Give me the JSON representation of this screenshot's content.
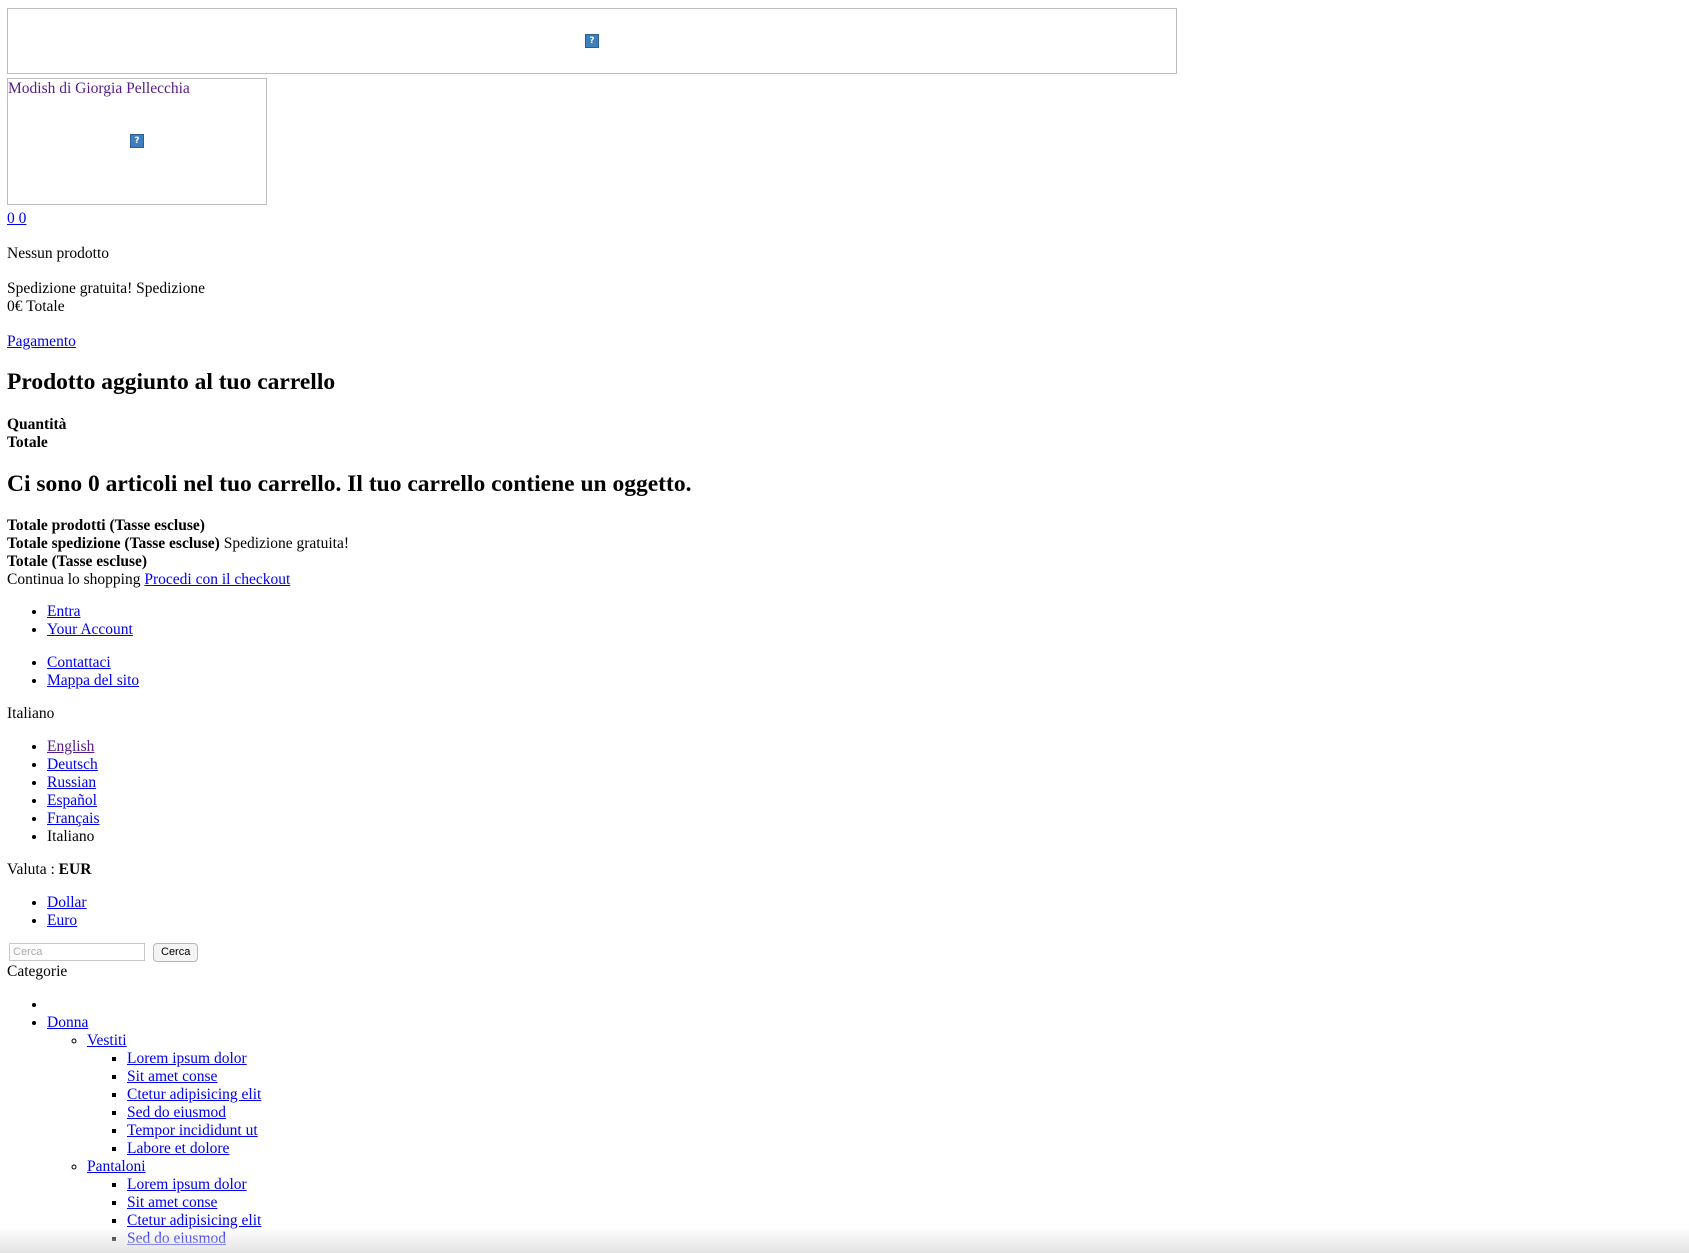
{
  "header": {
    "banner_icon": "broken-image-icon",
    "logo_text": "Modish di Giorgia Pellecchia",
    "logo_icon": "broken-image-icon"
  },
  "cart": {
    "count_link": "0 0",
    "empty_text": "Nessun prodotto",
    "shipping_line": "Spedizione gratuita! Spedizione",
    "total_line": "0€ Totale",
    "checkout_link": "Pagamento"
  },
  "layer_cart": {
    "title": "Prodotto aggiunto al tuo carrello",
    "quantity_label": "Quantità",
    "total_label": "Totale",
    "summary_heading": "Ci sono 0 articoli nel tuo carrello. Il tuo carrello contiene un oggetto.",
    "products_total_label": "Totale prodotti (Tasse escluse)",
    "shipping_total_label": "Totale spedizione (Tasse escluse)",
    "shipping_total_value": "Spedizione gratuita!",
    "grand_total_label": "Totale (Tasse escluse)",
    "continue_label": "Continua lo shopping",
    "proceed_link": "Procedi con il checkout"
  },
  "user_nav": [
    {
      "label": "Entra"
    },
    {
      "label": "Your Account"
    }
  ],
  "contact_nav": [
    {
      "label": "Contattaci"
    },
    {
      "label": "Mappa del sito"
    }
  ],
  "language": {
    "current": "Italiano",
    "options": [
      {
        "label": "English",
        "visited": true
      },
      {
        "label": "Deutsch"
      },
      {
        "label": "Russian"
      },
      {
        "label": "Español"
      },
      {
        "label": "Français"
      },
      {
        "label": "Italiano",
        "current": true
      }
    ]
  },
  "currency": {
    "label": "Valuta :",
    "value": "EUR",
    "options": [
      {
        "label": "Dollar"
      },
      {
        "label": "Euro"
      }
    ]
  },
  "search": {
    "placeholder": "Cerca",
    "button": "Cerca"
  },
  "categories": {
    "title": "Categorie",
    "top": "Donna",
    "groups": [
      {
        "label": "Vestiti",
        "items": [
          "Lorem ipsum dolor",
          "Sit amet conse",
          "Ctetur adipisicing elit",
          "Sed do eiusmod",
          "Tempor incididunt ut",
          "Labore et dolore"
        ]
      },
      {
        "label": "Pantaloni",
        "items": [
          "Lorem ipsum dolor",
          "Sit amet conse",
          "Ctetur adipisicing elit",
          "Sed do eiusmod"
        ]
      }
    ]
  },
  "colors": {
    "link": "#0000ee",
    "visited_link": "#551a8b",
    "text": "#000000",
    "image_border": "#bdbdbd"
  }
}
